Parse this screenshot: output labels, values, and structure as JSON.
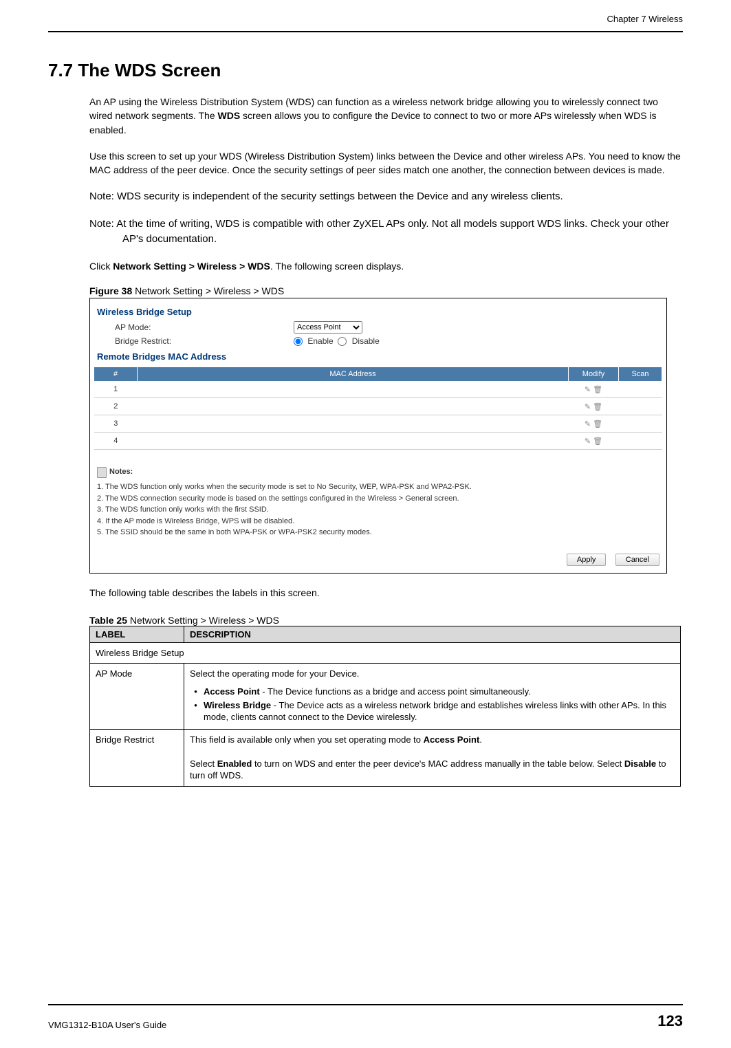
{
  "header": {
    "chapter": "Chapter 7 Wireless"
  },
  "section": {
    "number_title": "7.7  The WDS Screen",
    "para1a": "An AP using the Wireless Distribution System (WDS) can function as a wireless network bridge allowing you to wirelessly connect two wired network segments. The ",
    "para1b_bold": "WDS",
    "para1c": " screen allows you to configure the Device to connect to two or more APs wirelessly when WDS is enabled.",
    "para2": "Use this screen to set up your WDS (Wireless Distribution System) links between the Device and other wireless APs. You need to know the MAC address of the peer device. Once the security settings of peer sides match one another, the connection between devices is made.",
    "note1": "Note: WDS security is independent of the security settings between the Device and any wireless clients.",
    "note2": "Note: At the time of writing, WDS is compatible with other ZyXEL APs only. Not all models support WDS links. Check your other AP's documentation.",
    "click_a": "Click ",
    "click_bold": "Network Setting > Wireless > WDS",
    "click_b": ". The following screen displays.",
    "fig_label": "Figure 38",
    "fig_caption": "   Network Setting > Wireless > WDS",
    "after_fig": "The following table describes the labels in this screen.",
    "tbl_label": "Table 25",
    "tbl_caption": "   Network Setting > Wireless > WDS"
  },
  "gui": {
    "section1": "Wireless Bridge Setup",
    "ap_mode_label": "AP Mode:",
    "ap_mode_value": "Access Point",
    "bridge_restrict_label": "Bridge Restrict:",
    "enable": "Enable",
    "disable": "Disable",
    "section2": "Remote Bridges MAC Address",
    "th_num": "#",
    "th_mac": "MAC Address",
    "th_modify": "Modify",
    "th_scan": "Scan",
    "rows": [
      "1",
      "2",
      "3",
      "4"
    ],
    "notes_label": "Notes:",
    "notes": [
      "1. The WDS function only works when the security mode is set to No Security, WEP, WPA-PSK and WPA2-PSK.",
      "2. The WDS connection security mode is based on the settings configured in the Wireless > General screen.",
      "3. The WDS function only works with the first SSID.",
      "4. If the AP mode is Wireless Bridge, WPS will be disabled.",
      "5. The SSID should be the same in both WPA-PSK or WPA-PSK2 security modes."
    ],
    "apply": "Apply",
    "cancel": "Cancel"
  },
  "labels_table": {
    "h_label": "LABEL",
    "h_desc": "DESCRIPTION",
    "r0": "Wireless Bridge Setup",
    "r1_label": "AP Mode",
    "r1_intro": "Select the operating mode for your Device.",
    "r1_b1_bold": "Access Point",
    "r1_b1_rest": "  - The Device functions as a bridge and access point simultaneously.",
    "r1_b2_bold": "Wireless Bridge",
    "r1_b2_rest": " - The Device acts as a wireless network bridge and establishes wireless links with other APs. In this mode, clients cannot connect to the Device wirelessly.",
    "r2_label": "Bridge Restrict",
    "r2_a": "This field is available only when you set operating mode to ",
    "r2_bold1": "Access Point",
    "r2_b": ".",
    "r2_c": "Select ",
    "r2_bold2": "Enabled",
    "r2_d": " to turn on WDS and enter the peer device's MAC address manually in the table below. Select ",
    "r2_bold3": "Disable",
    "r2_e": " to turn off WDS."
  },
  "footer": {
    "guide": "VMG1312-B10A User's Guide",
    "page": "123"
  }
}
